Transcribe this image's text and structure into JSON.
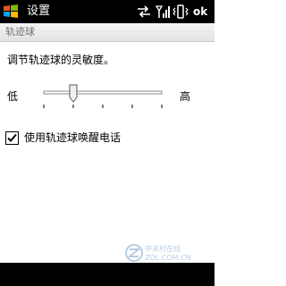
{
  "status_bar": {
    "title": "设置",
    "ok_label": "ok",
    "icons": [
      "windows-start-icon",
      "connectivity-icon",
      "signal-icon",
      "vibrate-icon"
    ]
  },
  "section": {
    "header": "轨迹球"
  },
  "content": {
    "description": "调节轨迹球的灵敏度。",
    "slider": {
      "low_label": "低",
      "high_label": "高",
      "value_fraction": 0.25,
      "tick_count": 5
    },
    "checkbox": {
      "label": "使用轨迹球唤醒电话",
      "checked": true
    }
  },
  "watermark": {
    "text": "ZOL.COM.CN",
    "text_cn": "中关村在线"
  }
}
